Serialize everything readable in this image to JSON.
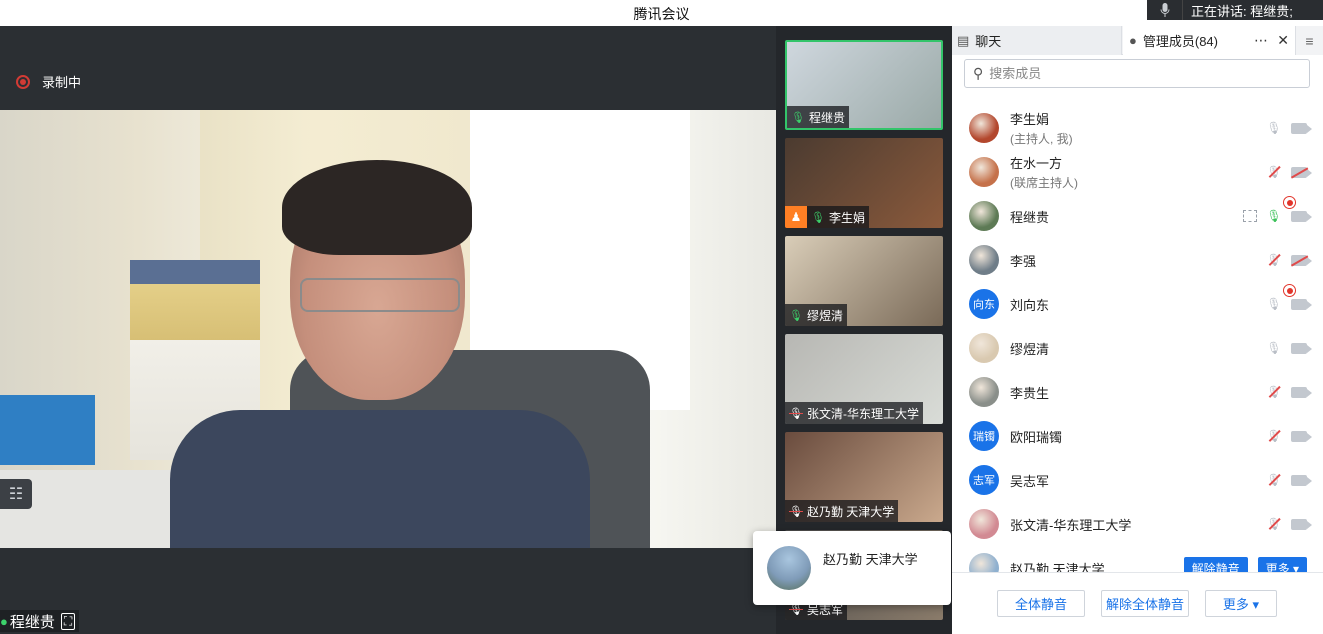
{
  "window": {
    "title": "腾讯会议"
  },
  "speaking": {
    "text": "正在讲话: 程继贵;"
  },
  "recording": {
    "label": "录制中"
  },
  "main_video": {
    "name": "程继贵"
  },
  "thumbnails": [
    {
      "name": "程继贵",
      "mic": "on",
      "active": true,
      "colors": [
        "#cfd7de",
        "#9aa9a7"
      ]
    },
    {
      "name": "李生娟",
      "mic": "on",
      "host": true,
      "colors": [
        "#4b3b30",
        "#8b5a3c"
      ]
    },
    {
      "name": "缪煜清",
      "mic": "on",
      "colors": [
        "#d9cdb8",
        "#7a6a58"
      ]
    },
    {
      "name": "张文清-华东理工大学",
      "mic": "off",
      "colors": [
        "#b7b7b3",
        "#d9dcd7"
      ]
    },
    {
      "name": "赵乃勤 天津大学",
      "mic": "off",
      "colors": [
        "#6a4c3e",
        "#caa98d"
      ]
    },
    {
      "name": "吴志军",
      "mic": "off",
      "colors": [
        "#4a4a4a",
        "#8a7b6a"
      ]
    }
  ],
  "popup": {
    "name": "赵乃勤 天津大学"
  },
  "panel": {
    "tab_chat": "聊天",
    "tab_members": "管理成员(84)",
    "more_icon": "⋯",
    "close_icon": "✕",
    "menu_icon": "≡",
    "search_placeholder": "搜索成员"
  },
  "members": [
    {
      "name": "李生娟",
      "sub": "(主持人, 我)",
      "avatar": "photo",
      "avatar_color": "#b3472d",
      "icons": [
        "mic",
        "cam"
      ]
    },
    {
      "name": "在水一方",
      "sub": "(联席主持人)",
      "avatar": "photo",
      "avatar_color": "#c5714a",
      "icons": [
        "rec",
        "mic-off",
        "cam-off"
      ]
    },
    {
      "name": "程继贵",
      "avatar": "photo",
      "avatar_color": "#5d7a55",
      "icons": [
        "share",
        "mic-on",
        "cam"
      ]
    },
    {
      "name": "李强",
      "avatar": "photo",
      "avatar_color": "#6f7d88",
      "icons": [
        "rec",
        "mic-off",
        "cam-off"
      ]
    },
    {
      "name": "刘向东",
      "avatar": "text",
      "avatar_text": "向东",
      "icons": [
        "mic",
        "cam"
      ]
    },
    {
      "name": "缪煜清",
      "avatar": "photo",
      "avatar_color": "#d9c9b0",
      "icons": [
        "mic",
        "cam"
      ]
    },
    {
      "name": "李贵生",
      "avatar": "photo",
      "avatar_color": "#8a8f8a",
      "icons": [
        "mic-off",
        "cam"
      ]
    },
    {
      "name": "欧阳瑞镯",
      "avatar": "text",
      "avatar_text": "瑞镯",
      "icons": [
        "mic-off",
        "cam"
      ]
    },
    {
      "name": "吴志军",
      "avatar": "text",
      "avatar_text": "志军",
      "icons": [
        "mic-off",
        "cam"
      ]
    },
    {
      "name": "张文清-华东理工大学",
      "avatar": "photo",
      "avatar_color": "#d28a93",
      "icons": [
        "mic-off",
        "cam"
      ]
    },
    {
      "name": "赵乃勤 天津大学",
      "avatar": "photo",
      "avatar_color": "#8fb0cf",
      "buttons": [
        "解除静音",
        "更多 ▾"
      ]
    }
  ],
  "footer": {
    "mute_all": "全体静音",
    "unmute_all": "解除全体静音",
    "more": "更多 ▾"
  }
}
